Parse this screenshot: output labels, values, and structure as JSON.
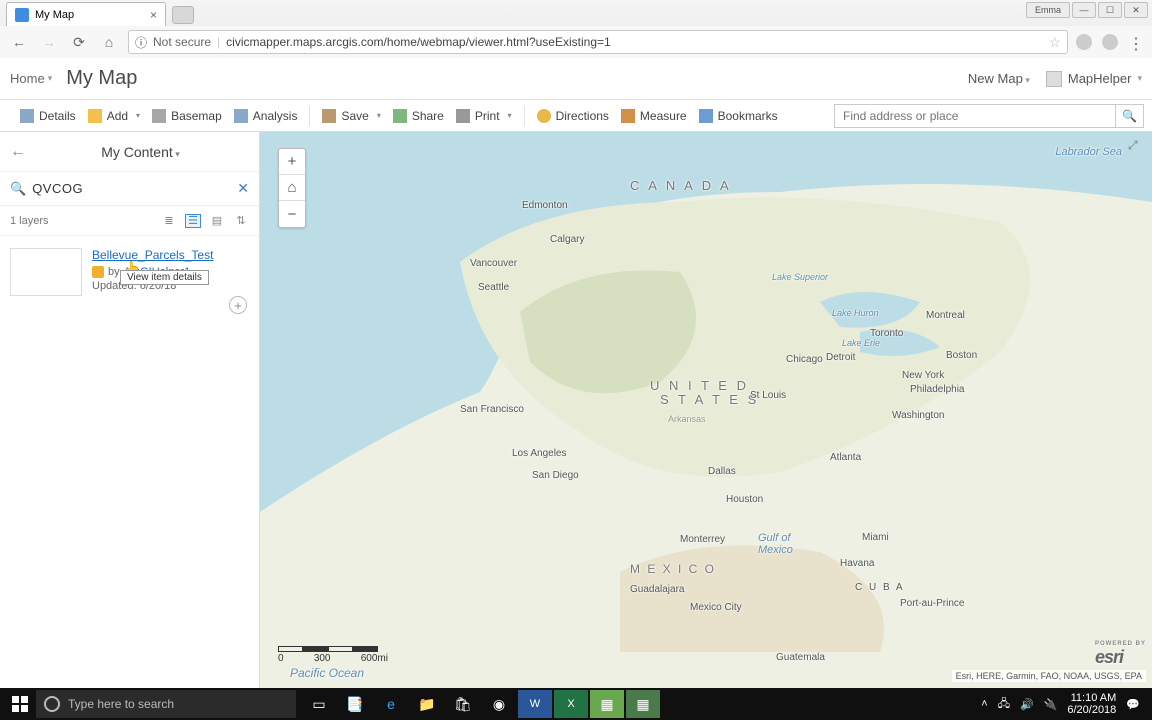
{
  "browser": {
    "tab_title": "My Map",
    "security_label": "Not secure",
    "url": "civicmapper.maps.arcgis.com/home/webmap/viewer.html?useExisting=1",
    "user_badge": "Emma"
  },
  "header": {
    "home": "Home",
    "title": "My Map",
    "new_map": "New Map",
    "username": "MapHelper"
  },
  "toolbar": {
    "details": "Details",
    "add": "Add",
    "basemap": "Basemap",
    "analysis": "Analysis",
    "save": "Save",
    "share": "Share",
    "print": "Print",
    "directions": "Directions",
    "measure": "Measure",
    "bookmarks": "Bookmarks",
    "search_placeholder": "Find address or place"
  },
  "panel": {
    "title": "My Content",
    "search_value": "QVCOG",
    "layer_count": "1 layers",
    "result": {
      "title": "Bellevue_Parcels_Test",
      "by_prefix": "by",
      "author": "ArcGIHelper1",
      "updated": "Updated: 6/20/18",
      "tooltip": "View item details"
    }
  },
  "map": {
    "labels": {
      "canada": "C A N A D A",
      "united_states_1": "U N I T E D",
      "united_states_2": "S T A T E S",
      "mexico": "M E X I C O",
      "cuba": "C U B A",
      "labrador_sea": "Labrador Sea",
      "gulf_of_mexico_1": "Gulf of",
      "gulf_of_mexico_2": "Mexico",
      "pacific_ocean": "Pacific Ocean",
      "lake_superior": "Lake Superior",
      "lake_huron": "Lake Huron",
      "lake_erie": "Lake Erie"
    },
    "cities": {
      "edmonton": "Edmonton",
      "calgary": "Calgary",
      "vancouver": "Vancouver",
      "seattle": "Seattle",
      "san_francisco": "San Francisco",
      "los_angeles": "Los Angeles",
      "san_diego": "San Diego",
      "dallas": "Dallas",
      "houston": "Houston",
      "st_louis": "St Louis",
      "chicago": "Chicago",
      "detroit": "Detroit",
      "toronto": "Toronto",
      "montreal": "Montreal",
      "boston": "Boston",
      "new_york": "New York",
      "philadelphia": "Philadelphia",
      "washington": "Washington",
      "atlanta": "Atlanta",
      "miami": "Miami",
      "monterrey": "Monterrey",
      "guadalajara": "Guadalajara",
      "mexico_city": "Mexico City",
      "havana": "Havana",
      "port_au_prince": "Port-au-Prince",
      "guatemala": "Guatemala",
      "arkansas": "Arkansas"
    },
    "scale": {
      "t0": "0",
      "t1": "300",
      "t2": "600mi"
    },
    "attribution": "Esri, HERE, Garmin, FAO, NOAA, USGS, EPA",
    "esri": "esri",
    "powered": "POWERED BY"
  },
  "taskbar": {
    "search_placeholder": "Type here to search",
    "time": "11:10 AM",
    "date": "6/20/2018"
  }
}
